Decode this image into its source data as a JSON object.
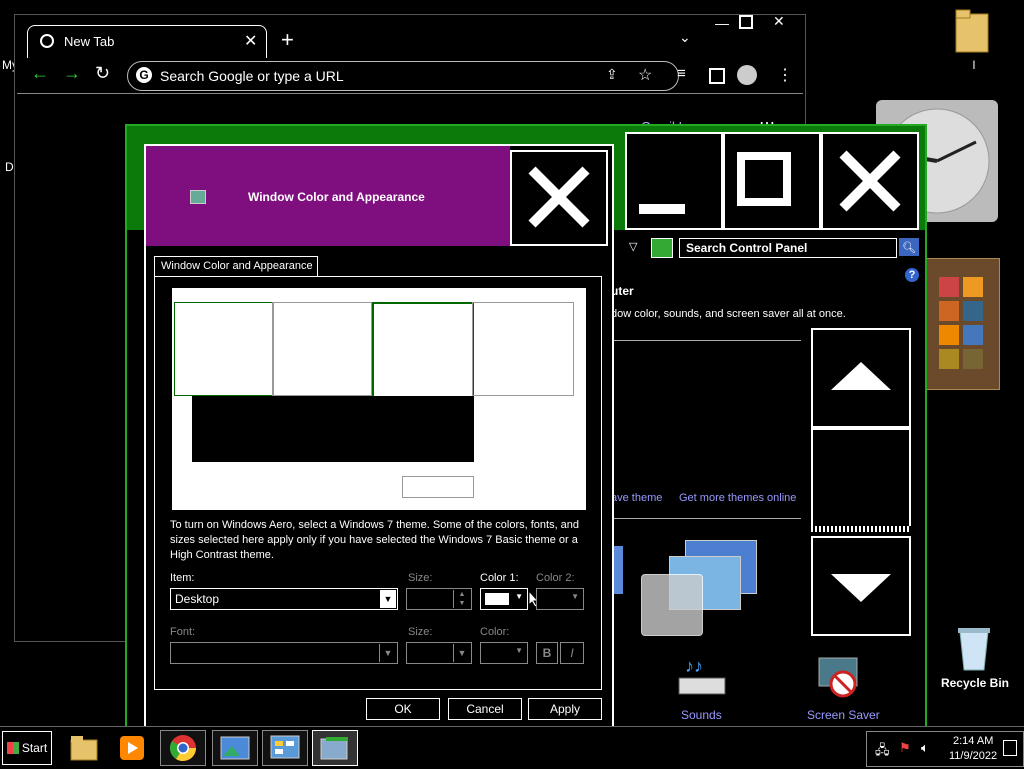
{
  "desktop": {
    "recycle_bin_label": "Recycle Bin",
    "folder_label": "l",
    "left_label_1": "My",
    "left_label_2": "D"
  },
  "chrome": {
    "tab_title": "New Tab",
    "url_placeholder": "Search Google or type a URL",
    "gmail_partial": "Gmail  Images"
  },
  "control_panel": {
    "search_placeholder": "Search Control Panel",
    "heading_partial": "uter",
    "desc_partial": "dow color, sounds, and screen saver all at once.",
    "save_theme_link": "ave theme",
    "get_more_themes_link": "Get more themes online",
    "sounds_label": "Sounds",
    "screen_saver_label": "Screen Saver"
  },
  "dialog": {
    "title": "Window Color and Appearance",
    "tab_label": "Window Color and Appearance",
    "info_text": "To turn on Windows Aero, select a Windows 7 theme.  Some of the colors, fonts, and sizes selected here apply only if you have selected the Windows 7 Basic theme or a High Contrast theme.",
    "item_label": "Item:",
    "item_value": "Desktop",
    "size_label": "Size:",
    "color1_label": "Color 1:",
    "color2_label": "Color 2:",
    "font_label": "Font:",
    "font_size_label": "Size:",
    "font_color_label": "Color:",
    "bold_label": "B",
    "italic_label": "I",
    "ok_label": "OK",
    "cancel_label": "Cancel",
    "apply_label": "Apply"
  },
  "taskbar": {
    "start_label": "Start",
    "time": "2:14 AM",
    "date": "11/9/2022"
  },
  "colors": {
    "dialog_title": "#7f0f7f",
    "cp_title": "#0b7a0b",
    "accent_green": "#2a2"
  }
}
